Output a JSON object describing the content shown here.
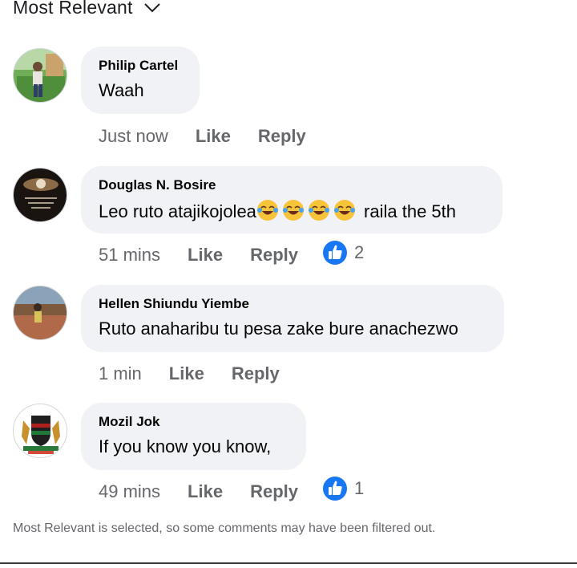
{
  "sort": {
    "label": "Most Relevant"
  },
  "comments": [
    {
      "author": "Philip Cartel",
      "text": "Waah",
      "time": "Just now",
      "like": "Like",
      "reply": "Reply"
    },
    {
      "author": "Douglas N. Bosire",
      "text_prefix": "Leo ruto atajikojolea",
      "emoji": [
        "laughing-crying-emoji",
        "laughing-crying-emoji",
        "laughing-crying-emoji",
        "laughing-crying-emoji"
      ],
      "text_suffix": " raila the 5th",
      "time": "51 mins",
      "like": "Like",
      "reply": "Reply",
      "reaction": {
        "icon": "thumbs-up-icon",
        "count": "2"
      }
    },
    {
      "author": "Hellen Shiundu Yiembe",
      "text": "Ruto anaharibu tu pesa zake bure anachezwo",
      "time": "1 min",
      "like": "Like",
      "reply": "Reply"
    },
    {
      "author": "Mozil Jok",
      "text": "If you know you know,",
      "time": "49 mins",
      "like": "Like",
      "reply": "Reply",
      "reaction": {
        "icon": "thumbs-up-icon",
        "count": "1"
      }
    }
  ],
  "footer": {
    "note": "Most Relevant is selected, so some comments may have been filtered out."
  },
  "colors": {
    "bubble": "#f0f2f5",
    "muted": "#65676b",
    "like_blue": "#1877f2"
  }
}
